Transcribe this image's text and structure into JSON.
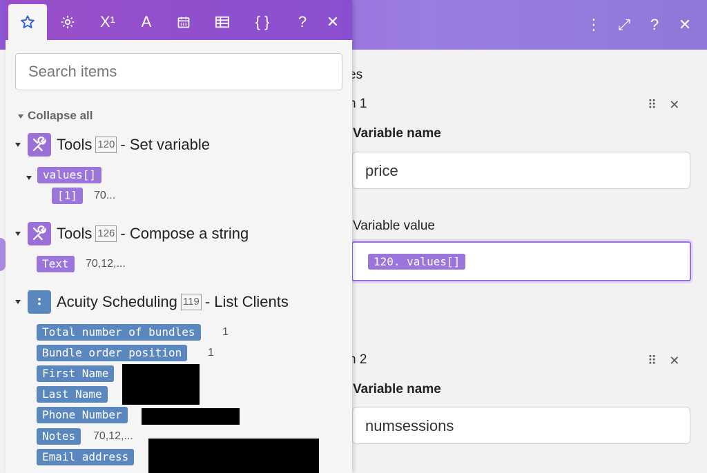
{
  "modal": {
    "header_icons": [
      "more-vertical-icon",
      "expand-icon",
      "help-icon",
      "close-icon"
    ],
    "header_glyphs": [
      "⋮",
      "⤢",
      "?",
      "✕"
    ],
    "partial_header_text": "es",
    "item1": {
      "partial_label": "n 1",
      "name_label": "Variable name",
      "name_value": "price",
      "value_label": "Variable value",
      "value_pill": "120. values[]"
    },
    "item2": {
      "partial_label": "n 2",
      "name_label": "Variable name",
      "name_value": "numsessions"
    },
    "item_control_glyphs": [
      "⠿",
      "✕"
    ]
  },
  "panel": {
    "tabs": [
      {
        "name": "favorites",
        "icon": "star-icon",
        "active": true
      },
      {
        "name": "settings",
        "icon": "gear-icon",
        "active": false
      },
      {
        "name": "math",
        "icon": "superscript-icon",
        "glyph": "X¹",
        "active": false
      },
      {
        "name": "text",
        "icon": "text-icon",
        "glyph": "A",
        "active": false
      },
      {
        "name": "date",
        "icon": "calendar-icon",
        "active": false
      },
      {
        "name": "array",
        "icon": "table-icon",
        "active": false
      },
      {
        "name": "general",
        "icon": "braces-icon",
        "glyph": "{ }",
        "active": false
      }
    ],
    "help_glyph": "?",
    "close_glyph": "✕",
    "search_placeholder": "Search items",
    "collapse_all": "Collapse all",
    "groups": [
      {
        "app": "Tools",
        "id": "120",
        "action": "- Set variable",
        "children": [
          {
            "label": "values[]",
            "color": "purple",
            "children": [
              {
                "label": "[1]",
                "value": "70..."
              }
            ]
          }
        ]
      },
      {
        "app": "Tools",
        "id": "126",
        "action": "- Compose a string",
        "children": [
          {
            "label": "Text",
            "value": "70,12,..."
          }
        ]
      },
      {
        "app": "Acuity Scheduling",
        "id": "119",
        "action": "- List Clients",
        "children": [
          {
            "label": "Total number of bundles",
            "value": "1"
          },
          {
            "label": "Bundle order position",
            "value": "1"
          },
          {
            "label": "First Name",
            "value": ""
          },
          {
            "label": "Last Name",
            "value": ""
          },
          {
            "label": "Phone Number",
            "value": ""
          },
          {
            "label": "Notes",
            "value": "70,12,..."
          },
          {
            "label": "Email address",
            "value": ""
          }
        ]
      }
    ]
  },
  "colors": {
    "header_purple": "#8d57d6",
    "tab_active_icon": "#2b5fd0",
    "tools_pill": "#9a76dc",
    "acuity_pill": "#5b87bf"
  }
}
